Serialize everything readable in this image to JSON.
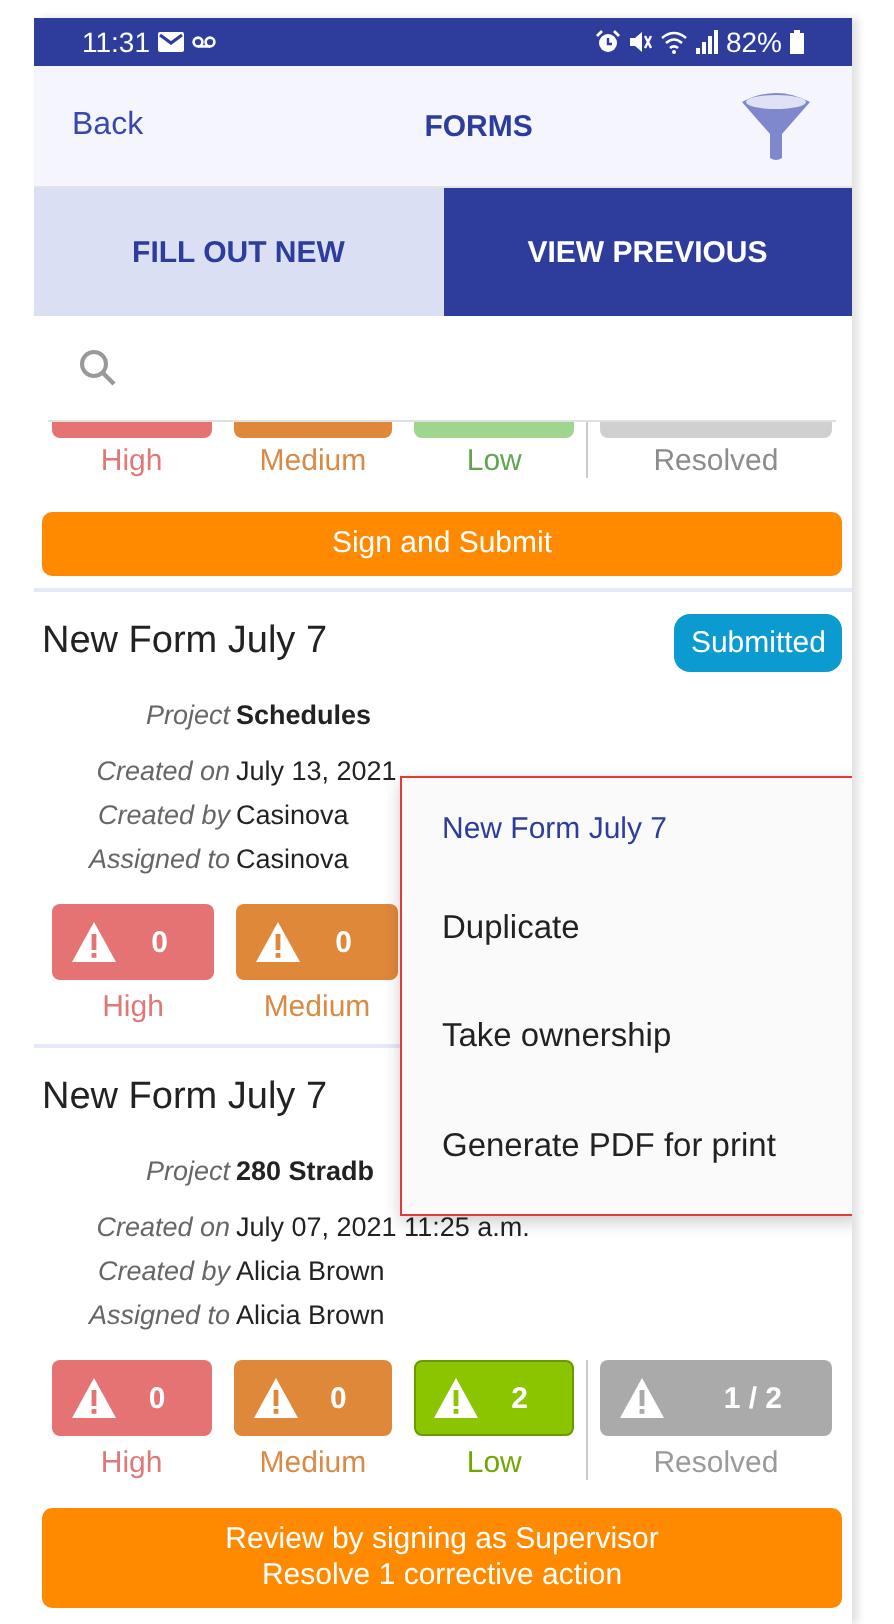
{
  "status_bar": {
    "time": "11:31",
    "battery": "82%"
  },
  "header": {
    "back": "Back",
    "title": "FORMS"
  },
  "tabs": [
    {
      "label": "FILL OUT NEW",
      "selected": false
    },
    {
      "label": "VIEW PREVIOUS",
      "selected": true
    }
  ],
  "forms": [
    {
      "tiles": [
        {
          "kind": "high",
          "label": "High",
          "active": false
        },
        {
          "kind": "medium",
          "label": "Medium",
          "active": false
        },
        {
          "kind": "low",
          "label": "Low",
          "active": false
        },
        {
          "kind": "resolved",
          "label": "Resolved",
          "active": false
        }
      ],
      "action": "Sign and Submit"
    },
    {
      "title": "New Form July 7",
      "badge": "Submitted",
      "details": [
        {
          "label": "Project",
          "value": "Schedules",
          "kind": "project"
        },
        {
          "label": "Created on",
          "value": "July 13, 2021",
          "kind": "plain"
        },
        {
          "label": "Created by",
          "value": "Casinova",
          "kind": "plain"
        },
        {
          "label": "Assigned to",
          "value": "Casinova",
          "kind": "plain"
        }
      ],
      "tiles": [
        {
          "kind": "high",
          "label": "High",
          "count": "0",
          "active": false
        },
        {
          "kind": "medium",
          "label": "Medium",
          "count": "0",
          "active": false
        }
      ]
    },
    {
      "title": "New Form July 7",
      "details": [
        {
          "label": "Project",
          "value": "280 Stradb",
          "kind": "project"
        },
        {
          "label": "Created on",
          "value": "July 07, 2021 11:25 a.m.",
          "kind": "plain"
        },
        {
          "label": "Created by",
          "value": "Alicia  Brown",
          "kind": "plain"
        },
        {
          "label": "Assigned to",
          "value": "Alicia  Brown",
          "kind": "plain"
        }
      ],
      "tiles": [
        {
          "kind": "high",
          "label": "High",
          "count": "0",
          "active": false
        },
        {
          "kind": "medium",
          "label": "Medium",
          "count": "0",
          "active": false
        },
        {
          "kind": "low",
          "label": "Low",
          "count": "2",
          "active": true
        },
        {
          "kind": "resolved",
          "label": "Resolved",
          "count": "1 / 2",
          "active": true
        }
      ],
      "action": "Review by signing as Supervisor\nResolve 1 corrective action"
    }
  ],
  "menu": {
    "title": "New Form July 7",
    "items": [
      "Duplicate",
      "Take ownership",
      "Generate PDF for print"
    ]
  }
}
